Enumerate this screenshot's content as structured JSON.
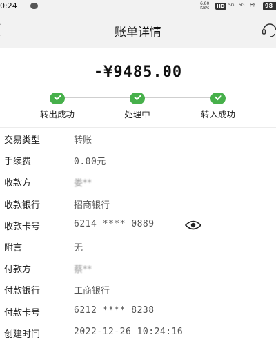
{
  "status_bar": {
    "time": "0:24",
    "speed": "6.80\nKB/s",
    "hd": "HD",
    "sig1": "5G",
    "sig2": "5G",
    "battery": "98"
  },
  "header": {
    "title": "账单详情"
  },
  "amount": "-¥9485.00",
  "steps": [
    {
      "label": "转出成功",
      "done": true
    },
    {
      "label": "处理中",
      "done": true
    },
    {
      "label": "转入成功",
      "done": true
    }
  ],
  "details": [
    {
      "label": "交易类型",
      "value": "转账"
    },
    {
      "label": "手续费",
      "value": "0.00元"
    },
    {
      "label": "收款方",
      "value": "娄**"
    },
    {
      "label": "收款银行",
      "value": "招商银行"
    },
    {
      "label": "收款卡号",
      "value": "6214 **** 0889"
    },
    {
      "label": "附言",
      "value": "无"
    },
    {
      "label": "付款方",
      "value": "蔡**"
    },
    {
      "label": "付款银行",
      "value": "工商银行"
    },
    {
      "label": "付款卡号",
      "value": "6212 **** 8238"
    },
    {
      "label": "创建时间",
      "value": "2022-12-26 10:24:16"
    }
  ],
  "colors": {
    "success": "#47b04b",
    "appbar": "#f2f2f2"
  },
  "icons": {
    "back": "chevron-left-icon",
    "service": "headset-icon",
    "card_visibility": "eye-icon"
  }
}
